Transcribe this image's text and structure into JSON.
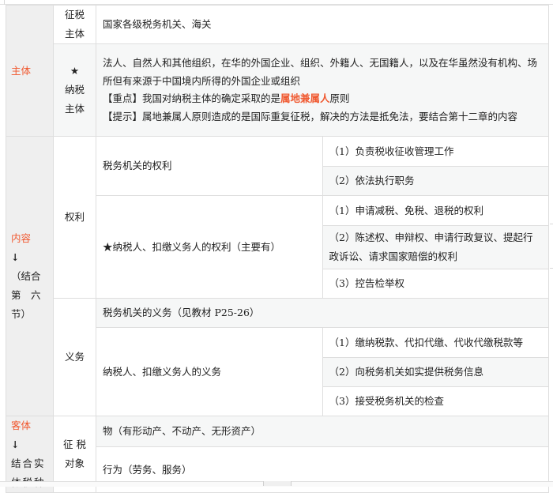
{
  "subject": {
    "label": "主体",
    "collector": {
      "label_line1": "征税",
      "label_line2": "主体",
      "content": "国家各级税务机关、海关"
    },
    "taxpayer": {
      "star": "★",
      "label_line1": "纳税",
      "label_line2": "主体",
      "line1": "法人、自然人和其他组织，在华的外国企业、组织、外籍人、无国籍人，以及在华虽然没有机构、场所但有来源于中国境内所得的外国企业或组织",
      "key_point_prefix": "【重点】我国对纳税主体的确定采取的是",
      "key_point_highlight": "属地兼属人",
      "key_point_suffix": "原则",
      "tip": "【提示】属地兼属人原则造成的是国际重复征税，解决的方法是抵免法，要结合第十二章的内容"
    }
  },
  "content": {
    "label": "内容",
    "arrow": "↓",
    "note_line1": "（结合",
    "note_line2": "第　六",
    "note_line3": "节）",
    "rights": {
      "label": "权利",
      "authority": {
        "label": "税务机关的权利",
        "items": [
          "（1）负责税收征收管理工作",
          "（2）依法执行职务"
        ]
      },
      "taxpayer": {
        "label": "★纳税人、扣缴义务人的权利（主要有）",
        "items": [
          "（1）申请减税、免税、退税的权利",
          "（2）陈述权、申辩权、申请行政复议、提起行政诉讼、请求国家赔偿的权利",
          "（3）控告检举权"
        ]
      }
    },
    "obligations": {
      "label": "义务",
      "authority": "税务机关的义务（见教材 P25-26）",
      "taxpayer": {
        "label": "纳税人、扣缴义务人的义务",
        "items": [
          "（1）缴纳税款、代扣代缴、代收代缴税款等",
          "（2）向税务机关如实提供税务信息",
          "（3）接受税务机关的检查"
        ]
      }
    }
  },
  "object": {
    "label": "客体",
    "arrow": "↓",
    "note": "结合实体税种",
    "tax_object": {
      "label": "征 税 对象",
      "items": [
        "物（有形动产、不动产、无形资产）",
        "行为（劳务、服务）"
      ]
    }
  }
}
